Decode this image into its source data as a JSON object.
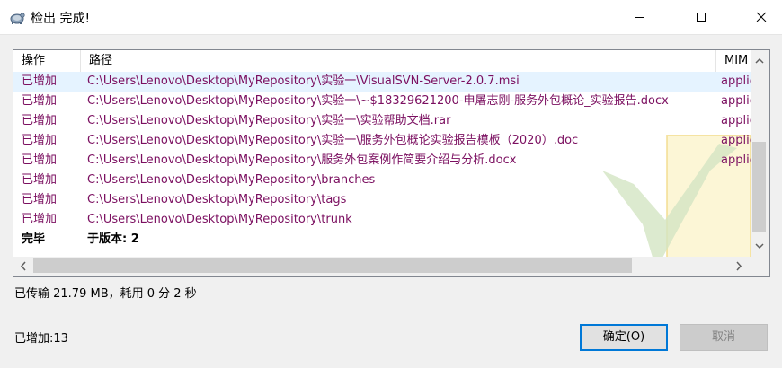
{
  "window": {
    "title": "检出 完成!",
    "app_icon": "tortoise-svn-icon",
    "controls": [
      "minimize-icon",
      "maximize-icon",
      "close-icon"
    ]
  },
  "table": {
    "columns": [
      "操作",
      "路径",
      "MIM"
    ],
    "rows": [
      {
        "op": "已增加",
        "path": "C:\\Users\\Lenovo\\Desktop\\MyRepository\\实验一\\VisualSVN-Server-2.0.7.msi",
        "mime": "applic",
        "kind": "added",
        "selected": true
      },
      {
        "op": "已增加",
        "path": "C:\\Users\\Lenovo\\Desktop\\MyRepository\\实验一\\~$18329621200-申屠志刚-服务外包概论_实验报告.docx",
        "mime": "applic",
        "kind": "added"
      },
      {
        "op": "已增加",
        "path": "C:\\Users\\Lenovo\\Desktop\\MyRepository\\实验一\\实验帮助文档.rar",
        "mime": "applic",
        "kind": "added"
      },
      {
        "op": "已增加",
        "path": "C:\\Users\\Lenovo\\Desktop\\MyRepository\\实验一\\服务外包概论实验报告模板（2020）.doc",
        "mime": "applic",
        "kind": "added"
      },
      {
        "op": "已增加",
        "path": "C:\\Users\\Lenovo\\Desktop\\MyRepository\\服务外包案例作简要介绍与分析.docx",
        "mime": "applic",
        "kind": "added"
      },
      {
        "op": "已增加",
        "path": "C:\\Users\\Lenovo\\Desktop\\MyRepository\\branches",
        "mime": "",
        "kind": "added"
      },
      {
        "op": "已增加",
        "path": "C:\\Users\\Lenovo\\Desktop\\MyRepository\\tags",
        "mime": "",
        "kind": "added"
      },
      {
        "op": "已增加",
        "path": "C:\\Users\\Lenovo\\Desktop\\MyRepository\\trunk",
        "mime": "",
        "kind": "added"
      },
      {
        "op": "完毕",
        "path": "于版本: 2",
        "mime": "",
        "kind": "done"
      }
    ]
  },
  "status": {
    "transfer": "已传输 21.79 MB，耗用 0 分 2 秒",
    "added": "已增加:13"
  },
  "buttons": {
    "ok": "确定(O)",
    "cancel": "取消"
  },
  "colors": {
    "added_text": "#7b0f60",
    "selected_row": "#e5f3ff",
    "focus_border": "#0078d7"
  }
}
